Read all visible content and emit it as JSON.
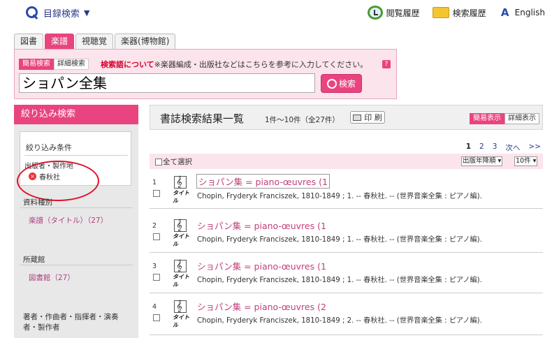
{
  "header": {
    "catalog_label": "目録検索",
    "catalog_caret": "▼",
    "links": [
      {
        "label": "閲覧履歴",
        "icon": "history-icon"
      },
      {
        "label": "検索履歴",
        "icon": "folder-icon"
      },
      {
        "label": "English",
        "icon": "language-icon"
      }
    ]
  },
  "tabs": [
    "図書",
    "楽譜",
    "視聴覚",
    "楽器(博物館)"
  ],
  "active_tab": "楽譜",
  "search": {
    "mode_simple": "簡易検索",
    "mode_detail": "詳細検索",
    "note_red": "検索語について",
    "note_rest": "※楽器編成・出版社などはこちらを参考に入力してください。",
    "help": "?",
    "query": "ショパン全集",
    "button": "検索"
  },
  "sidebar": {
    "heading": "絞り込み検索",
    "conditions_title": "絞り込み条件",
    "condition_label": "出版者・製作地",
    "condition_value": "春秋社",
    "facet1_title": "資料種別",
    "facet1_link": "楽譜（タイトル）（27）",
    "facet2_title": "所蔵館",
    "facet2_link": "図書館（27）",
    "facet3_title_line1": "著者・作曲者・指揮者・演奏",
    "facet3_title_line2": "者・製作者"
  },
  "results": {
    "title": "書誌検索結果一覧",
    "count": "1件～10件（全27件）",
    "print": "印 刷",
    "view_simple": "簡易表示",
    "view_detail": "詳細表示",
    "pager": {
      "current": "1",
      "pages": [
        "2",
        "3"
      ],
      "next": "次へ",
      "last": ">>"
    },
    "select_all": "全て選択",
    "sort": "出版年降順",
    "per_page": "10件",
    "thumb_caption": "タイトル",
    "items": [
      {
        "num": "1",
        "title": "ショパン集 = piano-œuvres (1",
        "desc": "Chopin, Fryderyk Franciszek, 1810-1849 ; 1. -- 春秋社. -- (世界音楽全集 : ピアノ編)."
      },
      {
        "num": "2",
        "title": "ショパン集 = piano-œuvres (1",
        "desc": "Chopin, Fryderyk Franciszek, 1810-1849 ; 1. -- 春秋社. -- (世界音楽全集 : ピアノ編)."
      },
      {
        "num": "3",
        "title": "ショパン集 = piano-œuvres (1",
        "desc": "Chopin, Fryderyk Franciszek, 1810-1849 ; 1. -- 春秋社. -- (世界音楽全集 : ピアノ編)."
      },
      {
        "num": "4",
        "title": "ショパン集 = piano-œuvres (2",
        "desc": "Chopin, Fryderyk Franciszek, 1810-1849 ; 2. -- 春秋社. -- (世界音楽全集 : ピアノ編)."
      }
    ]
  },
  "colors": {
    "accent": "#e9447f",
    "link": "#c0407a",
    "annotation": "#e0102c"
  }
}
